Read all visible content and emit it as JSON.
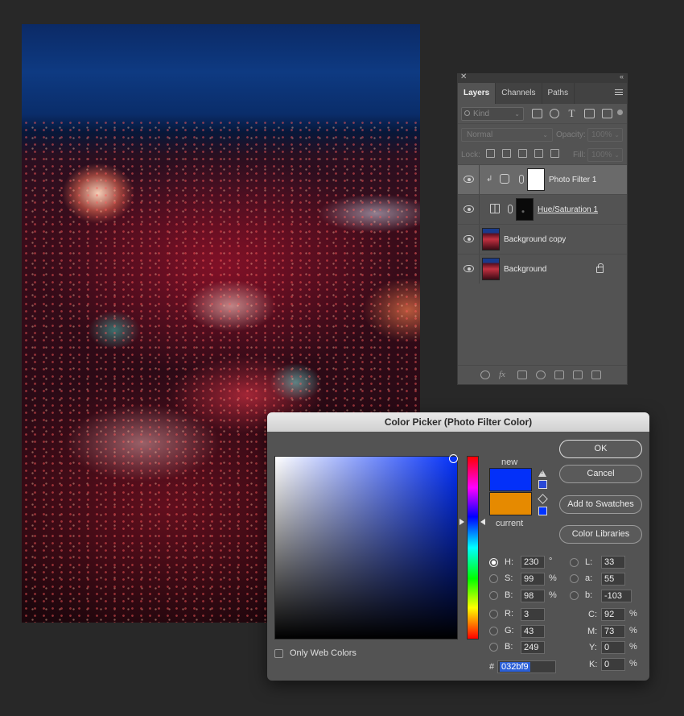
{
  "layers_panel": {
    "tabs": [
      "Layers",
      "Channels",
      "Paths"
    ],
    "kind_placeholder": "Kind",
    "blend_mode": "Normal",
    "opacity_label": "Opacity:",
    "opacity_value": "100%",
    "lock_label": "Lock:",
    "fill_label": "Fill:",
    "fill_value": "100%",
    "layers": [
      {
        "name": "Photo Filter 1",
        "selected": true
      },
      {
        "name": "Hue/Saturation 1",
        "selected": false
      },
      {
        "name": "Background copy",
        "selected": false
      },
      {
        "name": "Background",
        "selected": false,
        "locked": true
      }
    ]
  },
  "color_picker": {
    "title": "Color Picker (Photo Filter Color)",
    "new_label": "new",
    "current_label": "current",
    "new_color": "#0330f9",
    "current_color": "#e68a00",
    "buttons": {
      "ok": "OK",
      "cancel": "Cancel",
      "add_to_swatches": "Add to Swatches",
      "color_libraries": "Color Libraries"
    },
    "hsb": {
      "h_label": "H:",
      "h": "230",
      "h_unit": "°",
      "s_label": "S:",
      "s": "99",
      "s_unit": "%",
      "b_label": "B:",
      "b": "98",
      "b_unit": "%"
    },
    "rgb": {
      "r_label": "R:",
      "r": "3",
      "g_label": "G:",
      "g": "43",
      "b_label": "B:",
      "b": "249"
    },
    "lab": {
      "l_label": "L:",
      "l": "33",
      "a_label": "a:",
      "a": "55",
      "b_label": "b:",
      "b": "-103"
    },
    "cmyk": {
      "c_label": "C:",
      "c": "92",
      "m_label": "M:",
      "m": "73",
      "y_label": "Y:",
      "y": "0",
      "k_label": "K:",
      "k": "0",
      "unit": "%"
    },
    "hex_label": "#",
    "hex": "032bf9",
    "only_web_colors": "Only Web Colors"
  }
}
